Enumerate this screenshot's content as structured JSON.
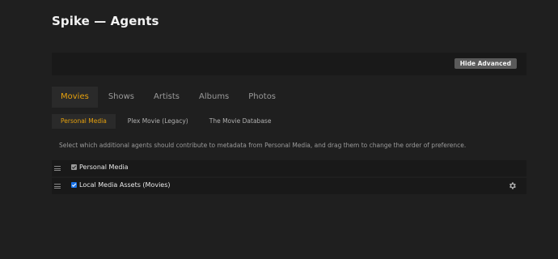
{
  "page": {
    "title": "Spike — Agents"
  },
  "toolbar": {
    "hide_advanced_label": "Hide Advanced"
  },
  "tabs": [
    {
      "label": "Movies",
      "active": true
    },
    {
      "label": "Shows",
      "active": false
    },
    {
      "label": "Artists",
      "active": false
    },
    {
      "label": "Albums",
      "active": false
    },
    {
      "label": "Photos",
      "active": false
    }
  ],
  "subtabs": [
    {
      "label": "Personal Media",
      "active": true
    },
    {
      "label": "Plex Movie (Legacy)",
      "active": false
    },
    {
      "label": "The Movie Database",
      "active": false
    }
  ],
  "description": "Select which additional agents should contribute to metadata from Personal Media, and drag them to change the order of preference.",
  "agents": [
    {
      "label": "Personal Media",
      "checked": true,
      "disabled": true,
      "has_settings": false
    },
    {
      "label": "Local Media Assets (Movies)",
      "checked": true,
      "disabled": false,
      "has_settings": true
    }
  ],
  "colors": {
    "accent": "#e5a00d",
    "checkbox_active": "#1a73e8",
    "background": "#1f1f1f",
    "panel": "#191919"
  },
  "icons": {
    "drag": "drag-handle-icon",
    "settings": "gear-icon"
  }
}
